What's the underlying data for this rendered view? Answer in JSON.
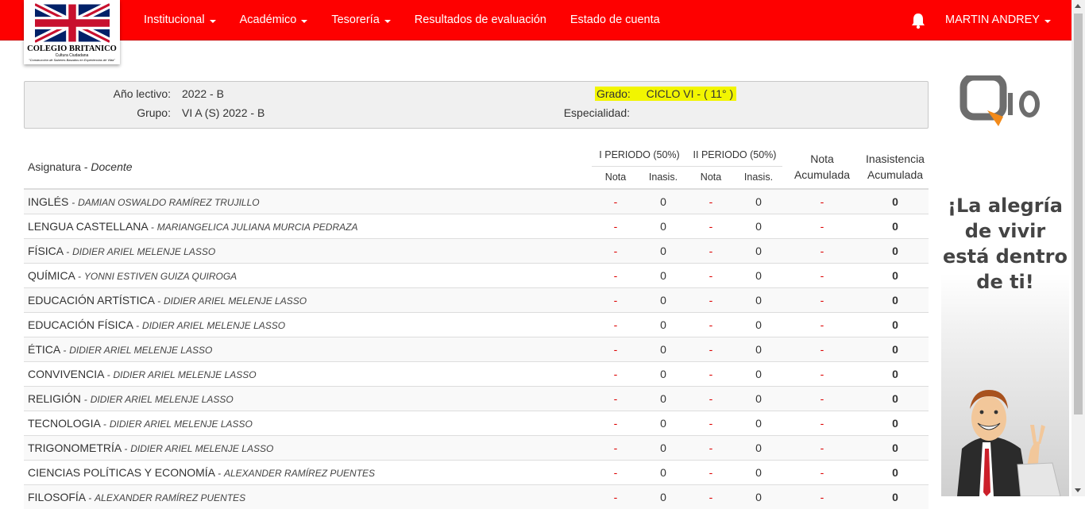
{
  "logo": {
    "line1": "COLEGIO BRITANICO",
    "line2": "Cultura Ciudadana",
    "line3": "\"Construcción de Saberes Basados en Experiencias de Vida\""
  },
  "nav": {
    "items": [
      {
        "label": "Institucional",
        "dropdown": true
      },
      {
        "label": "Académico",
        "dropdown": true
      },
      {
        "label": "Tesorería",
        "dropdown": true
      },
      {
        "label": "Resultados de evaluación",
        "dropdown": false
      },
      {
        "label": "Estado de cuenta",
        "dropdown": false
      }
    ],
    "user": "MARTIN ANDREY",
    "bell_icon": "bell-icon",
    "bg_color": "#fe0000"
  },
  "info": {
    "anio_label": "Año lectivo:",
    "anio_value": "2022 - B",
    "grupo_label": "Grupo:",
    "grupo_value": "VI A (S) 2022 - B",
    "grado_label": "Grado:",
    "grado_value": "CICLO VI - ( 11° )",
    "especialidad_label": "Especialidad:"
  },
  "table": {
    "col_subject": "Asignatura",
    "col_teacher": "Docente",
    "period1": "I PERIODO (50%)",
    "period2": "II PERIODO (50%)",
    "sub_nota": "Nota",
    "sub_inasis": "Inasis.",
    "col_nota_acum_1": "Nota",
    "col_nota_acum_2": "Acumulada",
    "col_inas_acum_1": "Inasistencia",
    "col_inas_acum_2": "Acumulada",
    "rows": [
      {
        "subject": "INGLÉS",
        "teacher": "DAMIAN OSWALDO RAMÍREZ TRUJILLO",
        "n1": "-",
        "i1": "0",
        "n2": "-",
        "i2": "0",
        "na": "-",
        "ia": "0"
      },
      {
        "subject": "LENGUA CASTELLANA",
        "teacher": "MARIANGELICA JULIANA MURCIA PEDRAZA",
        "n1": "-",
        "i1": "0",
        "n2": "-",
        "i2": "0",
        "na": "-",
        "ia": "0"
      },
      {
        "subject": "FÍSICA",
        "teacher": "DIDIER ARIEL MELENJE LASSO",
        "n1": "-",
        "i1": "0",
        "n2": "-",
        "i2": "0",
        "na": "-",
        "ia": "0"
      },
      {
        "subject": "QUÍMICA",
        "teacher": "YONNI ESTIVEN GUIZA QUIROGA",
        "n1": "-",
        "i1": "0",
        "n2": "-",
        "i2": "0",
        "na": "-",
        "ia": "0"
      },
      {
        "subject": "EDUCACIÓN ARTÍSTICA",
        "teacher": "DIDIER ARIEL MELENJE LASSO",
        "n1": "-",
        "i1": "0",
        "n2": "-",
        "i2": "0",
        "na": "-",
        "ia": "0"
      },
      {
        "subject": "EDUCACIÓN FÍSICA",
        "teacher": "DIDIER ARIEL MELENJE LASSO",
        "n1": "-",
        "i1": "0",
        "n2": "-",
        "i2": "0",
        "na": "-",
        "ia": "0"
      },
      {
        "subject": "ÉTICA",
        "teacher": "DIDIER ARIEL MELENJE LASSO",
        "n1": "-",
        "i1": "0",
        "n2": "-",
        "i2": "0",
        "na": "-",
        "ia": "0"
      },
      {
        "subject": "CONVIVENCIA",
        "teacher": "DIDIER ARIEL MELENJE LASSO",
        "n1": "-",
        "i1": "0",
        "n2": "-",
        "i2": "0",
        "na": "-",
        "ia": "0"
      },
      {
        "subject": "RELIGIÓN",
        "teacher": "DIDIER ARIEL MELENJE LASSO",
        "n1": "-",
        "i1": "0",
        "n2": "-",
        "i2": "0",
        "na": "-",
        "ia": "0"
      },
      {
        "subject": "TECNOLOGIA",
        "teacher": "DIDIER ARIEL MELENJE LASSO",
        "n1": "-",
        "i1": "0",
        "n2": "-",
        "i2": "0",
        "na": "-",
        "ia": "0"
      },
      {
        "subject": "TRIGONOMETRÍA",
        "teacher": "DIDIER ARIEL MELENJE LASSO",
        "n1": "-",
        "i1": "0",
        "n2": "-",
        "i2": "0",
        "na": "-",
        "ia": "0"
      },
      {
        "subject": "CIENCIAS POLÍTICAS Y ECONOMÍA",
        "teacher": "ALEXANDER RAMÍREZ PUENTES",
        "n1": "-",
        "i1": "0",
        "n2": "-",
        "i2": "0",
        "na": "-",
        "ia": "0"
      },
      {
        "subject": "FILOSOFÍA",
        "teacher": "ALEXANDER RAMÍREZ PUENTES",
        "n1": "-",
        "i1": "0",
        "n2": "-",
        "i2": "0",
        "na": "-",
        "ia": "0"
      }
    ]
  },
  "ad": {
    "brand": "Q10",
    "line1": "¡La alegría",
    "line2": "de vivir",
    "line3": "está dentro",
    "line4": "de ti!"
  }
}
